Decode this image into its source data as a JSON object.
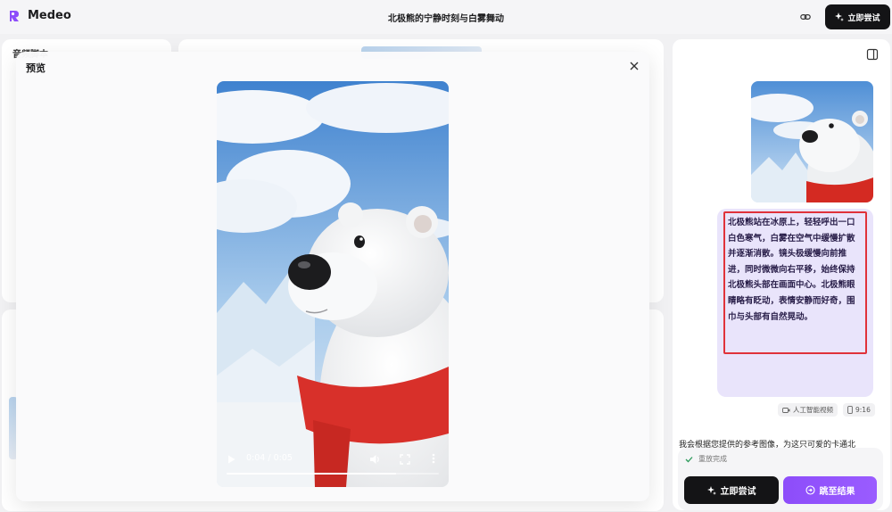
{
  "header": {
    "brand": "Medeo",
    "project_title": "北极熊的宁静时刻与白雾舞动",
    "try_now": "立即尝试"
  },
  "left_panel": {
    "title": "音频脚本"
  },
  "preview": {
    "title": "预览",
    "time": "0:04 / 0:05",
    "progress": 0.8
  },
  "sidebar": {
    "prompt_lines": [
      "北极熊站在冰原上，轻轻呼出一口",
      "白色寒气，白雾在空气中缓慢扩散",
      "并逐渐消散。镜头极缓慢向前推",
      "进，同时微微向右平移，始终保持",
      "北极熊头部在画面中心。北极熊眼",
      "睛略有眨动，表情安静而好奇，围",
      "巾与头部有自然晃动。"
    ],
    "meta_type": "人工智能视频",
    "meta_ratio": "9:16",
    "reply": "我会根据您提供的参考图像，为这只可爱的卡通北",
    "status": "重放完成",
    "try_now": "立即尝试",
    "jump": "跳至结果"
  },
  "colors": {
    "accent_purple": "#8d4dfa",
    "highlight_red": "#e0323a",
    "dark_button": "#141416",
    "bubble": "#e9e4fb"
  },
  "icons": [
    "logo-icon",
    "link-icon",
    "sparkle-icon",
    "panel-toggle-icon",
    "close-icon",
    "play-icon",
    "volume-icon",
    "fullscreen-icon",
    "more-icon",
    "video-icon",
    "phone-icon",
    "check-icon",
    "jump-icon"
  ]
}
